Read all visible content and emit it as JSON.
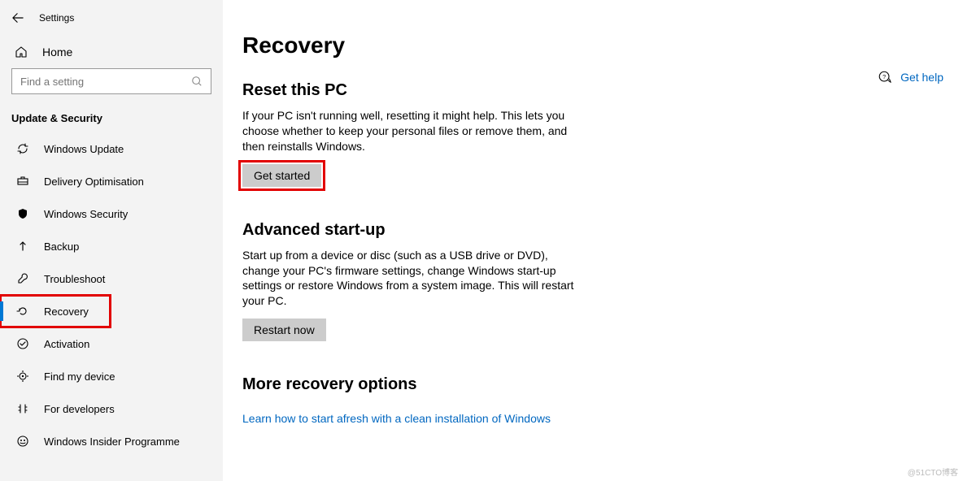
{
  "app": {
    "title": "Settings"
  },
  "sidebar": {
    "home": "Home",
    "search_placeholder": "Find a setting",
    "section": "Update & Security",
    "items": [
      {
        "label": "Windows Update"
      },
      {
        "label": "Delivery Optimisation"
      },
      {
        "label": "Windows Security"
      },
      {
        "label": "Backup"
      },
      {
        "label": "Troubleshoot"
      },
      {
        "label": "Recovery"
      },
      {
        "label": "Activation"
      },
      {
        "label": "Find my device"
      },
      {
        "label": "For developers"
      },
      {
        "label": "Windows Insider Programme"
      }
    ]
  },
  "main": {
    "title": "Recovery",
    "reset": {
      "heading": "Reset this PC",
      "desc": "If your PC isn't running well, resetting it might help. This lets you choose whether to keep your personal files or remove them, and then reinstalls Windows.",
      "button": "Get started"
    },
    "advanced": {
      "heading": "Advanced start-up",
      "desc": "Start up from a device or disc (such as a USB drive or DVD), change your PC's firmware settings, change Windows start-up settings or restore Windows from a system image. This will restart your PC.",
      "button": "Restart now"
    },
    "more": {
      "heading": "More recovery options",
      "link": "Learn how to start afresh with a clean installation of Windows"
    },
    "help": "Get help"
  },
  "watermark": "@51CTO博客"
}
